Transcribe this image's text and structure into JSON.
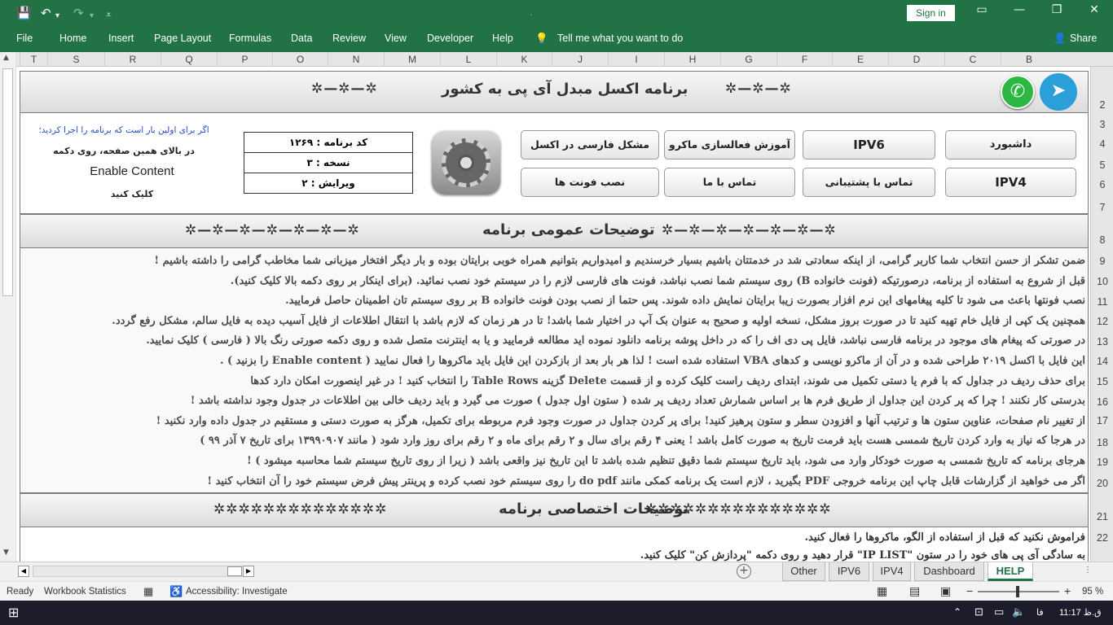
{
  "ribbon": {
    "menu": [
      "File",
      "Home",
      "Insert",
      "Page Layout",
      "Formulas",
      "Data",
      "Review",
      "View",
      "Developer",
      "Help"
    ],
    "tell_me": "Tell me what you want to do",
    "share": "Share",
    "sign_in": "Sign in"
  },
  "columns": [
    "T",
    "S",
    "R",
    "Q",
    "P",
    "O",
    "N",
    "M",
    "L",
    "K",
    "J",
    "I",
    "H",
    "G",
    "F",
    "E",
    "D",
    "C",
    "B"
  ],
  "rows": [
    "2",
    "3",
    "4",
    "5",
    "6",
    "7",
    "8",
    "9",
    "10",
    "11",
    "12",
    "13",
    "14",
    "15",
    "16",
    "17",
    "18",
    "19",
    "20",
    "21",
    "22"
  ],
  "header": {
    "title": "برنامه اکسل مبدل آی پی به کشور",
    "stars_left": "✲—✲—✲",
    "stars_right": "✲—✲—✲"
  },
  "buttons": {
    "dashboard": "داشبورد",
    "ipv6": "IPV6",
    "macro_training": "آموزش فعالسازی ماکرو",
    "persian_problem": "مشکل فارسی در اکسل",
    "ipv4": "IPV4",
    "support": "تماس با پشتیبانی",
    "contact": "تماس با ما",
    "install_fonts": "نصب فونت ها"
  },
  "info": {
    "code": "کد برنامه : ۱۲۶۹",
    "copy": "نسخه : ۳",
    "edition": "ویرایش : ۲"
  },
  "note": {
    "line1": "اگر برای اولین بار است که برنامه را اجرا کردید؛",
    "line2": "در بالای همین صفحه، روی دکمه",
    "line3": "Enable Content",
    "line4": "کلیک کنید"
  },
  "general": {
    "title": "توضیحات عمومی برنامه",
    "stars_left": "✲—✲—✲—✲—✲—✲—✲",
    "stars_right": "✲—✲—✲—✲—✲—✲—✲",
    "lines": [
      "ضمن تشکر از حسن انتخاب شما کاربر گرامی، از اینکه سعادتی شد در خدمتتان باشیم بسیار خرسندیم و امیدواریم بتوانیم همراه خوبی برایتان بوده و بار دیگر افتخار میزبانی شما مخاطب گرامی را داشته باشیم !",
      "قبل از شروع به استفاده از برنامه، درصورتیکه (فونت خانواده B) روی سیستم شما نصب نباشد، فونت های فارسی لازم را در سیستم خود نصب نمائید. (برای اینکار بر روی دکمه بالا کلیک کنید).",
      "نصب فونتها باعث می شود تا کلیه پیغامهای این نرم افزار بصورت زیبا برایتان نمایش داده شوند. پس حتما از نصب بودن فونت خانواده B بر روی سیستم تان اطمینان حاصل فرمایید.",
      "همچنین یک کپی از فایل خام تهیه کنید تا در صورت بروز مشکل، نسخه اولیه و صحیح به عنوان بک آپ در اختیار شما باشد! تا در هر زمان که لازم باشد با انتقال اطلاعات از فایل آسیب دیده به فایل سالم، مشکل رفع گردد.",
      "در صورتی که پیغام های موجود در برنامه فارسی نباشد، فایل پی دی اف را که در داخل پوشه برنامه دانلود نموده اید مطالعه فرمایید و یا به اینترنت متصل شده و روی دکمه صورتی رنگ بالا ( فارسی ) کلیک نمایید.",
      "این فایل با اکسل ۲۰۱۹ طراحی شده و در آن از ماکرو نویسی و کدهای VBA استفاده شده است ! لذا هر بار بعد از بازکردن این فایل باید ماکروها را فعال نمایید ( Enable content را بزنید ) .",
      "برای حذف ردیف در جداول که با فرم یا دستی تکمیل می شوند، ابتدای ردیف راست کلیک کرده و از قسمت Delete گزینه Table Rows را انتخاب کنید ! در غیر اینصورت امکان دارد کدها",
      "بدرستی کار نکنند ! چرا که پر کردن این جداول از طریق فرم ها بر اساس شمارش تعداد ردیف پر شده ( ستون اول جدول ) صورت می گیرد و باید ردیف خالی بین اطلاعات در جدول وجود نداشته باشد !",
      "از تغییر نام صفحات، عناوین ستون ها و ترتیب آنها و افزودن سطر و ستون پرهیز کنید! برای پر کردن جداول در صورت وجود فرم مربوطه برای تکمیل، هرگز به صورت دستی و مستقیم در جدول داده وارد نکنید !",
      "در هرجا که نیاز به وارد کردن تاریخ شمسی هست باید فرمت تاریخ به صورت کامل باشد ! یعنی ۴ رقم برای سال و ۲ رقم برای ماه و ۲ رقم برای روز وارد شود ( مانند ۱۳۹۹۰۹۰۷ برای تاریخ ۷ آذر ۹۹ )",
      "هرجای برنامه که تاریخ شمسی به صورت خودکار وارد می شود، باید تاریخ سیستم شما دقیق تنظیم شده باشد تا این تاریخ نیز واقعی باشد ( زیرا از روی تاریخ سیستم شما محاسبه میشود ) !",
      "اگر می خواهید از گزارشات قابل چاپ این برنامه خروجی PDF بگیرید ، لازم است یک برنامه کمکی مانند do pdf را روی سیستم خود نصب کرده و پرینتر پیش فرض سیستم خود را آن انتخاب کنید !"
    ]
  },
  "specific": {
    "title": "توضیحات اختصاصی برنامه",
    "stars_left": "✲✲✲✲✲✲✲✲✲✲✲✲✲✲",
    "stars_right": "✲✲✲✲✲✲✲✲✲✲✲✲✲✲✲",
    "lines": [
      "فراموش نکنید که قبل از استفاده از الگو، ماکروها را فعال کنید.",
      "به سادگی آی پی های خود را در ستون \"IP LIST\" قرار دهید و روی دکمه \"پردازش کن\" کلیک کنید."
    ]
  },
  "tabs": [
    "Other",
    "IPV6",
    "IPV4",
    "Dashboard",
    "HELP"
  ],
  "status": {
    "ready": "Ready",
    "workbook_stats": "Workbook Statistics",
    "accessibility": "Accessibility: Investigate",
    "zoom": "95 %"
  },
  "taskbar": {
    "time": "11:17 ق.ظ",
    "lang": "فا"
  }
}
